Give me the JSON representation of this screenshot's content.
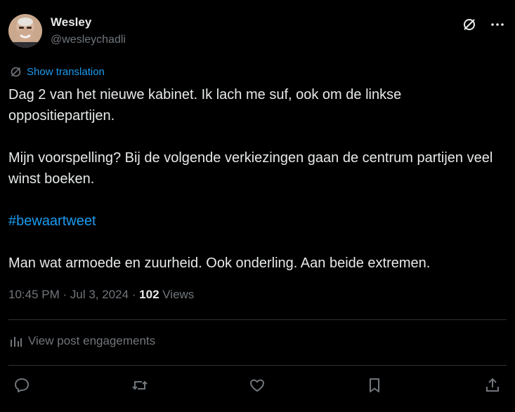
{
  "user": {
    "name": "Wesley",
    "handle": "@wesleychadli"
  },
  "header_icons": [
    "grok-icon",
    "more-icon"
  ],
  "translation": {
    "label": "Show translation",
    "icon": "translate-icon"
  },
  "tweet": {
    "lines": [
      "Dag 2 van het nieuwe kabinet. Ik lach me suf, ook om de linkse oppositiepartijen.",
      "Mijn voorspelling? Bij de volgende verkiezingen gaan de centrum partijen veel winst boeken.",
      "#bewaartweet",
      "Man wat armoede en zuurheid. Ook onderling. Aan beide extremen."
    ]
  },
  "meta": {
    "time": "10:45 PM",
    "separator1": " · ",
    "date": "Jul 3, 2024",
    "separator2": " · ",
    "views_count": "102",
    "views_label": " Views"
  },
  "engagements": {
    "label": "View post engagements",
    "icon": "analytics-icon"
  },
  "actions": [
    "reply-icon",
    "retweet-icon",
    "like-icon",
    "bookmark-icon",
    "share-icon"
  ],
  "colors": {
    "background": "#000000",
    "text": "#e7e9ea",
    "muted": "#71767b",
    "accent": "#1d9bf0",
    "divider": "#2f3336"
  }
}
